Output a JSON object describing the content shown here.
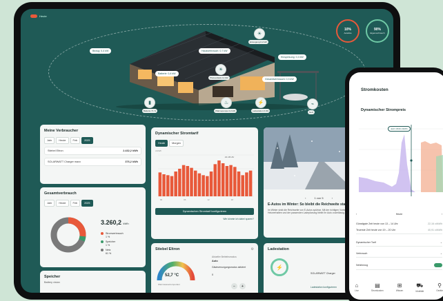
{
  "tablet": {
    "topbar_label": "Heute",
    "kpis": [
      {
        "value": "10%",
        "label": "Autarkie"
      },
      {
        "value": "90%",
        "label": "Eigenverbrauch"
      }
    ],
    "flow_labels": {
      "bezug": "Bezug: 0,4 kW",
      "batterie": "Batterie: 0,4 kW",
      "einspeisung": "Einspeisung: 0,3 kW",
      "hausverbrauch": "Hausverbrauch: 0,7 kW",
      "verbrauch": "Verbrauch: 0,3 kW",
      "gesamt": "Gesamtverbrauch: 0,3 kW"
    },
    "nodes": [
      {
        "label": "Photovoltaik 2,4 kW",
        "icon": "☀"
      },
      {
        "label": "Erzeugung 0,2 kW",
        "icon": "☀"
      },
      {
        "label": "Batterie 71 %",
        "icon": "▮"
      },
      {
        "label": "Wärmepumpe 0,2 kW",
        "icon": "♨"
      },
      {
        "label": "Ladestation 0 kW",
        "icon": "⚡"
      },
      {
        "label": "Netz",
        "icon": "⌁"
      }
    ],
    "verbraucher": {
      "title": "Meine Verbraucher",
      "tabs": [
        "Jahr",
        "Heute",
        "Feb",
        "2025"
      ],
      "active_tab": "2025",
      "rows": [
        {
          "name": "Stiebel Eltron",
          "value": "2.432,2 kWh"
        },
        {
          "name": "SOLARWATT Charger maxx",
          "value": "376,2 kWh"
        }
      ]
    },
    "gesamt": {
      "title": "Gesamtverbrauch",
      "tabs": [
        "Jahr",
        "Heute",
        "Feb",
        "2025"
      ],
      "active_tab": "2025",
      "value": "3.260,2",
      "unit": "kWh",
      "legend": [
        {
          "label": "Stromverbrauch",
          "pct": "1 %",
          "color": "#e8593a"
        },
        {
          "label": "Speicher",
          "pct": "1 %",
          "color": "#3a9a6a"
        },
        {
          "label": "Netz",
          "pct": "61 %",
          "color": "#777777"
        }
      ]
    },
    "speicher": {
      "title": "Speicher",
      "sub": "Battery vision"
    },
    "tarif": {
      "title": "Dynamischer Stromtarif",
      "tabs": [
        "Heute",
        "Morgen"
      ],
      "active_tab": "Heute",
      "ylabel": "ct/kWh",
      "peak_label": "Ab 18 Uhr",
      "button": "Dynamischen Stromtarif konfigurieren",
      "link": "Wie könnte ich dabei sparen?"
    },
    "news": {
      "pager": "1 von 5",
      "title": "E-Autos im Winter: So bleibt die Reichweite stabil",
      "text": "Im Winter sinkt die Reichweite von E-Autos spürbar. Mit der richtigen Vorbereitung, cleverem Heizverhalten und der passenden Ladeplanung bleibt Ihr Auto zuverlässig."
    },
    "stiebel": {
      "title": "Stiebel Eltron",
      "temp": "52,7 °C",
      "temp_label": "Warmwassertemperatur",
      "mode_label": "Aktueller Betriebsmodus",
      "mode_value": "Auto",
      "heat_label": "Gästeversorgungsmodus aktiviert",
      "heat_value": "0"
    },
    "lade": {
      "title": "Ladestation",
      "sub": "SOLARWATT Charger",
      "link": "Ladestation konfigurieren"
    }
  },
  "phone": {
    "title": "Stromkosten",
    "chart_title": "Dynamischer Strompreis",
    "marker": "Jetzt 18:00 ct/kWh",
    "nav": "Heute",
    "rows": [
      {
        "label": "Günstigste Zeit heute von 13 – 14 Uhr",
        "value": "22,16 ct/kWh"
      },
      {
        "label": "Teuerste Zeit heute von 19 – 20 Uhr",
        "value": "40,91 ct/kWh"
      }
    ],
    "toggles": [
      {
        "label": "Dynamischer Tarif"
      },
      {
        "label": "Verbrauch"
      },
      {
        "label": "Netzbezug"
      }
    ],
    "tabbar": [
      {
        "label": "Live",
        "icon": "⌂"
      },
      {
        "label": "Stromkosten",
        "icon": "▤"
      },
      {
        "label": "Wissen",
        "icon": "⊞"
      },
      {
        "label": "Mobilität",
        "icon": "⛟"
      },
      {
        "label": "Geräte",
        "icon": "⚲"
      }
    ]
  },
  "chart_data": [
    {
      "type": "bar",
      "title": "Dynamischer Stromtarif",
      "ylabel": "ct/kWh",
      "categories": [
        "00",
        "01",
        "02",
        "03",
        "04",
        "05",
        "06",
        "07",
        "08",
        "09",
        "10",
        "11",
        "12",
        "13",
        "14",
        "15",
        "16",
        "17",
        "18",
        "19",
        "20",
        "21",
        "22",
        "23"
      ],
      "values": [
        26,
        24,
        23,
        22,
        27,
        30,
        34,
        33,
        31,
        28,
        25,
        23,
        22,
        27,
        35,
        39,
        36,
        33,
        34,
        32,
        27,
        23,
        26,
        28
      ],
      "ylim": [
        0,
        45
      ]
    }
  ]
}
